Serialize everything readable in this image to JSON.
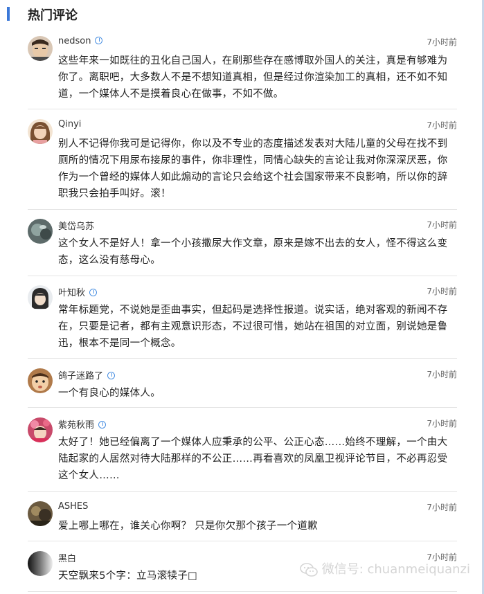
{
  "header": {
    "title": "热门评论"
  },
  "comments": [
    {
      "user": "nedson",
      "verified": true,
      "time": "7小时前",
      "text": "这些年来一如既往的丑化自己国人，在刷那些存在感博取外国人的关注，真是有够难为你了。离职吧，大多数人不是不想知道真相，但是经过你渲染加工的真相，还不如不知道，一个媒体人不是摸着良心在做事，不如不做。"
    },
    {
      "user": "Qinyi",
      "verified": false,
      "time": "7小时前",
      "text": "别人不记得你我可是记得你，你以及不专业的态度描述发表对大陆儿童的父母在找不到厕所的情况下用尿布接尿的事件，你非理性，同情心缺失的言论让我对你深深厌恶，你作为一个曾经的媒体人如此煽动的言论只会给这个社会国家带来不良影响，所以你的辞职我只会拍手叫好。滚！"
    },
    {
      "user": "美岱乌苏",
      "verified": false,
      "time": "7小时前",
      "text": "这个女人不是好人！拿一个小孩撒尿大作文章，原来是嫁不出去的女人，怪不得这么变态，这么没有慈母心。"
    },
    {
      "user": "叶知秋",
      "verified": true,
      "time": "7小时前",
      "text": "常年标题党，不说她是歪曲事实，但起码是选择性报道。说实话，绝对客观的新闻不存在，只要是记者，都有主观意识形态，不过很可惜，她站在祖国的对立面，别说她是鲁迅，根本不是同一个概念。"
    },
    {
      "user": "鸽子迷路了",
      "verified": true,
      "time": "7小时前",
      "text": "一个有良心的媒体人。"
    },
    {
      "user": "紫苑秋雨",
      "verified": true,
      "time": "7小时前",
      "text": "太好了！她已经偏离了一个媒体人应秉承的公平、公正心态……始终不理解，一个由大陆起家的人居然对待大陆那样的不公正……再看喜欢的凤凰卫视评论节目，不必再忍受这个女人……"
    },
    {
      "user": "ASHES",
      "verified": false,
      "time": "7小时前",
      "text": "爱上哪上哪在，谁关心你啊？ 只是你欠那个孩子一个道歉"
    },
    {
      "user": "黑白",
      "verified": false,
      "time": "7小时前",
      "text": "天空飘来5个字：立马滚犊子□"
    }
  ],
  "watermark": {
    "text": "微信号: chuanmeiquanzi"
  },
  "colors": {
    "accent": "#3b78d8",
    "verified": "#4a90e2",
    "divider": "#e3e3e3"
  }
}
